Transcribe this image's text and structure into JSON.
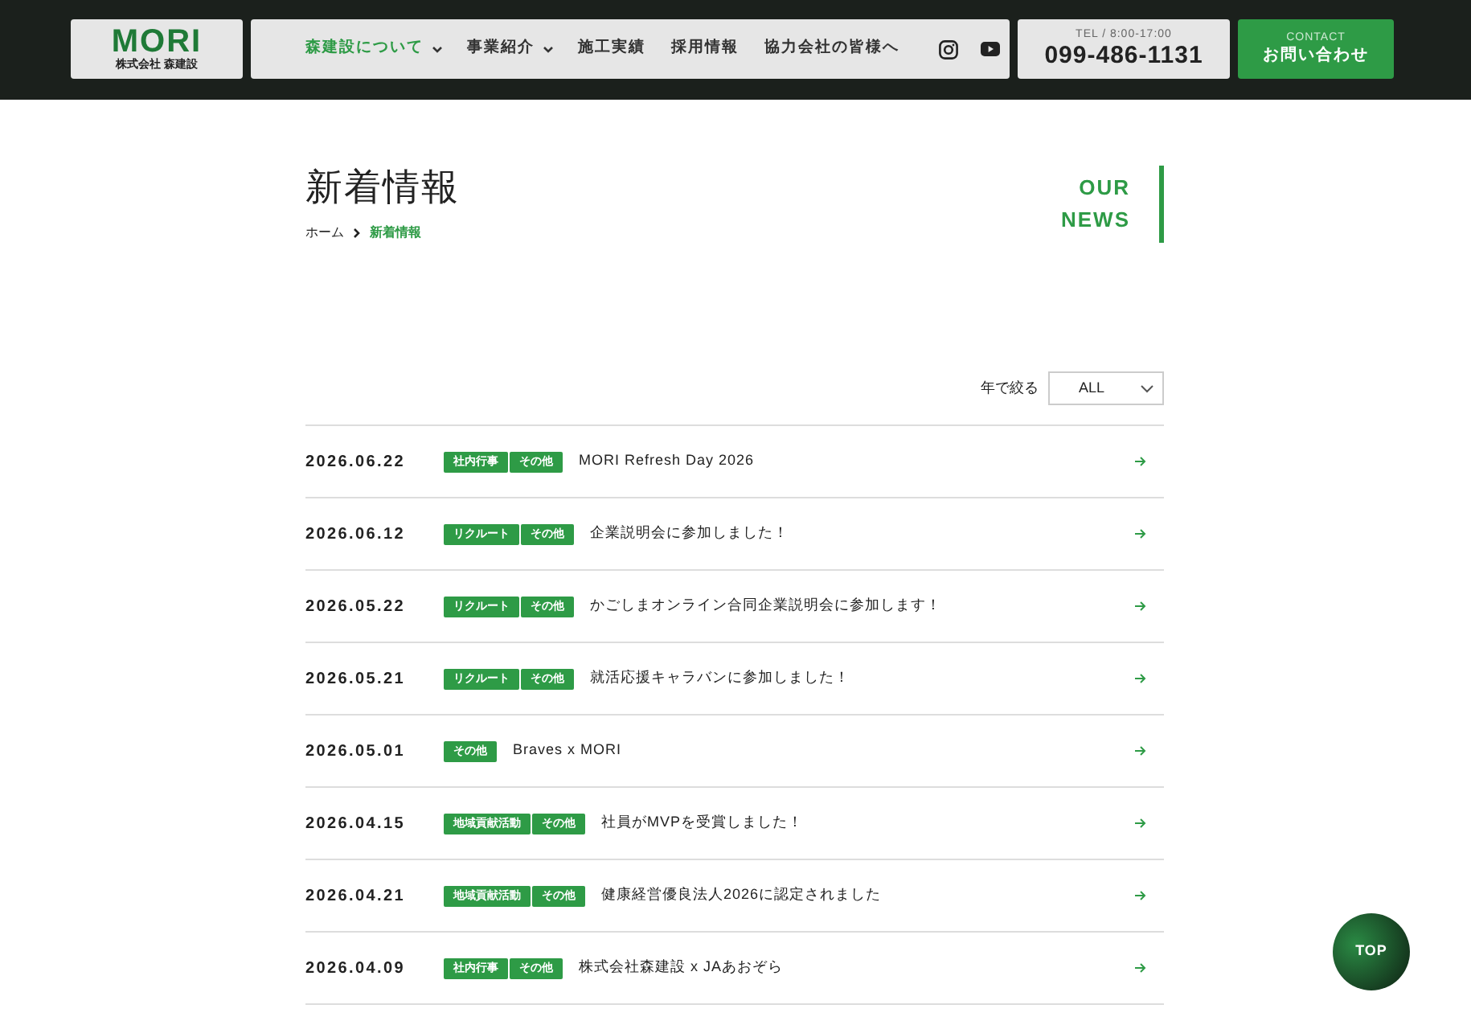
{
  "header": {
    "logo": {
      "wordmark": "MORI",
      "company": "株式会社 森建設"
    },
    "nav": [
      {
        "label": "森建設について",
        "selected": true,
        "dropdown": true
      },
      {
        "label": "事業紹介",
        "selected": false,
        "dropdown": true
      },
      {
        "label": "施工実績",
        "selected": false,
        "dropdown": false
      },
      {
        "label": "採用情報",
        "selected": false,
        "dropdown": false
      },
      {
        "label": "協力会社の皆様へ",
        "selected": false,
        "dropdown": false
      }
    ],
    "social": [
      {
        "kind": "instagram"
      },
      {
        "kind": "youtube"
      }
    ],
    "tel": {
      "caption": "TEL / 8:00-17:00",
      "number": "099-486-1131"
    },
    "contact": {
      "caption": "CONTACT",
      "label": "お問い合わせ"
    }
  },
  "page": {
    "title": "新着情報",
    "breadcrumb": [
      {
        "label": "ホーム",
        "current": false
      },
      {
        "label": "新着情報",
        "current": true
      }
    ],
    "english_title": [
      "OUR",
      "NEWS"
    ]
  },
  "filter": {
    "label": "年で絞る",
    "value": "ALL"
  },
  "news": [
    {
      "date": "2026.06.22",
      "tags": [
        "社内行事",
        "その他"
      ],
      "title": "MORI Refresh Day 2026"
    },
    {
      "date": "2026.06.12",
      "tags": [
        "リクルート",
        "その他"
      ],
      "title": "企業説明会に参加しました！"
    },
    {
      "date": "2026.05.22",
      "tags": [
        "リクルート",
        "その他"
      ],
      "title": "かごしまオンライン合同企業説明会に参加します！"
    },
    {
      "date": "2026.05.21",
      "tags": [
        "リクルート",
        "その他"
      ],
      "title": "就活応援キャラバンに参加しました！"
    },
    {
      "date": "2026.05.01",
      "tags": [
        "その他"
      ],
      "title": "Braves x MORI"
    },
    {
      "date": "2026.04.15",
      "tags": [
        "地域貢献活動",
        "その他"
      ],
      "title": "社員がMVPを受賞しました！"
    },
    {
      "date": "2026.04.21",
      "tags": [
        "地域貢献活動",
        "その他"
      ],
      "title": "健康経営優良法人2026に認定されました"
    },
    {
      "date": "2026.04.09",
      "tags": [
        "社内行事",
        "その他"
      ],
      "title": "株式会社森建設 x JAあおぞら"
    }
  ],
  "top_button": {
    "label": "TOP"
  }
}
